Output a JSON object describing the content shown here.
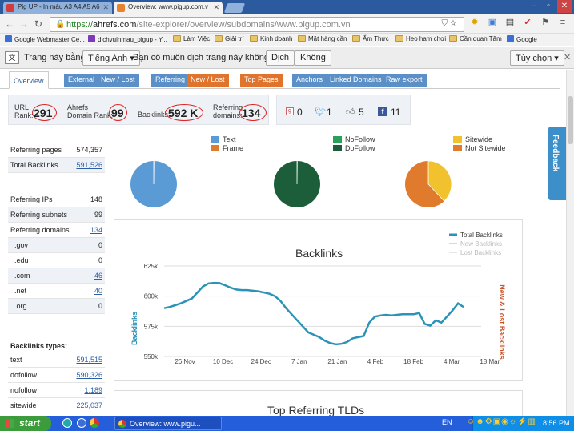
{
  "browser": {
    "tabs": [
      {
        "title": "Pig UP - In màu A3 A4 A5 A6"
      },
      {
        "title": "Overview: www.pigup.com.v"
      }
    ],
    "url_https": "https://",
    "url_host": "ahrefs.com",
    "url_path": "/site-explorer/overview/subdomains/www.pigup.com.vn",
    "bookmarks": [
      "Google Webmaster Ce...",
      "dichvuinmau_pigup - Y...",
      "Làm Việc",
      "Giải trí",
      "Kinh doanh",
      "Mặt hàng cần",
      "Ẩm Thực",
      "Heo ham chơi",
      "Cần quan Tâm",
      "Google"
    ]
  },
  "translate": {
    "prefix": "Trang này bằng",
    "language": "Tiếng Anh",
    "question": "Bạn có muốn dịch trang này không?",
    "translate_btn": "Dịch",
    "no_btn": "Không",
    "options_btn": "Tùy chọn"
  },
  "nav_tabs": [
    "Overview",
    "External",
    "New / Lost",
    "Referring",
    "New / Lost",
    "Top Pages",
    "Anchors",
    "Linked Domains",
    "Raw export"
  ],
  "ranks": {
    "url_rank_label_1": "URL",
    "url_rank_label_2": "Rank:",
    "url_rank": "291",
    "domain_rank_label_1": "Ahrefs",
    "domain_rank_label_2": "Domain Rank:",
    "domain_rank": "99",
    "backlinks_label": "Backlinks:",
    "backlinks": "592 K",
    "refdomains_label_1": "Referring",
    "refdomains_label_2": "domains:",
    "refdomains": "134"
  },
  "social": {
    "google": "0",
    "twitter": "1",
    "like": "5",
    "facebook": "11"
  },
  "stats_top": [
    {
      "label": "Referring pages",
      "value": "574,357",
      "link": false
    },
    {
      "label": "Total Backlinks",
      "value": "591,526",
      "link": true
    }
  ],
  "stats_mid": [
    {
      "label": "Referring IPs",
      "value": "148",
      "link": false
    },
    {
      "label": "Referring subnets",
      "value": "99",
      "link": false
    },
    {
      "label": "Referring domains",
      "value": "134",
      "link": true
    },
    {
      "label": ".gov",
      "value": "0",
      "link": false
    },
    {
      "label": ".edu",
      "value": "0",
      "link": false
    },
    {
      "label": ".com",
      "value": "46",
      "link": true
    },
    {
      "label": ".net",
      "value": "40",
      "link": true
    },
    {
      "label": ".org",
      "value": "0",
      "link": false
    }
  ],
  "backlink_types_title": "Backlinks types:",
  "backlink_types": [
    {
      "label": "text",
      "value": "591,515"
    },
    {
      "label": "dofollow",
      "value": "590,326"
    },
    {
      "label": "nofollow",
      "value": "1,189"
    },
    {
      "label": "sitewide",
      "value": "225,037"
    }
  ],
  "pie_legend": [
    {
      "label": "Text",
      "color": "#5b9bd5"
    },
    {
      "label": "Frame",
      "color": "#e07a2c"
    },
    {
      "label": "NoFollow",
      "color": "#2aa05a"
    },
    {
      "label": "DoFollow",
      "color": "#1c5e3a"
    },
    {
      "label": "Sitewide",
      "color": "#f2c12e"
    },
    {
      "label": "Not Sitewide",
      "color": "#e07a2c"
    }
  ],
  "pies": [
    {
      "first_label": "Frame",
      "first_value": 0.2,
      "rest_label": "Text",
      "rest_value": 99.8,
      "first_color": "#e07a2c",
      "rest_color": "#5b9bd5"
    },
    {
      "first_label": "NoFollow",
      "first_value": 0.2,
      "rest_label": "DoFollow",
      "rest_value": 99.8,
      "first_color": "#2aa05a",
      "rest_color": "#1c5e3a"
    },
    {
      "first_label": "Sitewide",
      "first_value": 38,
      "rest_label": "Not Sitewide",
      "rest_value": 62,
      "first_color": "#f2c12e",
      "rest_color": "#e07a2c"
    }
  ],
  "chart_data": {
    "type": "line",
    "title": "Backlinks",
    "ylabel": "Backlinks",
    "y2label": "New & Lost Backlinks",
    "ylim": [
      550000,
      625000
    ],
    "yticks": [
      "625k",
      "600k",
      "575k",
      "550k"
    ],
    "ytick_values": [
      625000,
      600000,
      575000,
      550000
    ],
    "xticks": [
      "26 Nov",
      "10 Dec",
      "24 Dec",
      "7 Jan",
      "21 Jan",
      "4 Feb",
      "18 Feb",
      "4 Mar",
      "18 Mar"
    ],
    "grid": true,
    "legend_position": "top-right",
    "series": [
      {
        "name": "Total Backlinks",
        "color": "#2b93b8",
        "values": [
          590000,
          591000,
          592500,
          594000,
          596000,
          598000,
          603000,
          608000,
          610500,
          611000,
          610800,
          609000,
          607000,
          605500,
          605000,
          605000,
          604500,
          604000,
          603000,
          602000,
          600000,
          596000,
          590000,
          585000,
          580000,
          575000,
          570000,
          568000,
          566000,
          563000,
          561000,
          560000,
          560500,
          562000,
          565000,
          566000,
          567000,
          578000,
          583000,
          584000,
          584500,
          584000,
          584500,
          585000,
          585000,
          585000,
          586000,
          577000,
          575500,
          580000,
          578000,
          583000,
          588000,
          594000,
          591000
        ]
      },
      {
        "name": "New Backlinks",
        "color": "#cccccc",
        "values": []
      },
      {
        "name": "Lost Backlinks",
        "color": "#dddddd",
        "values": []
      }
    ]
  },
  "next_panel_title": "Top Referring TLDs",
  "feedback_label": "Feedback",
  "taskbar": {
    "start": "start",
    "window": "Overview: www.pigu...",
    "lang": "EN",
    "time": "8:56 PM"
  }
}
